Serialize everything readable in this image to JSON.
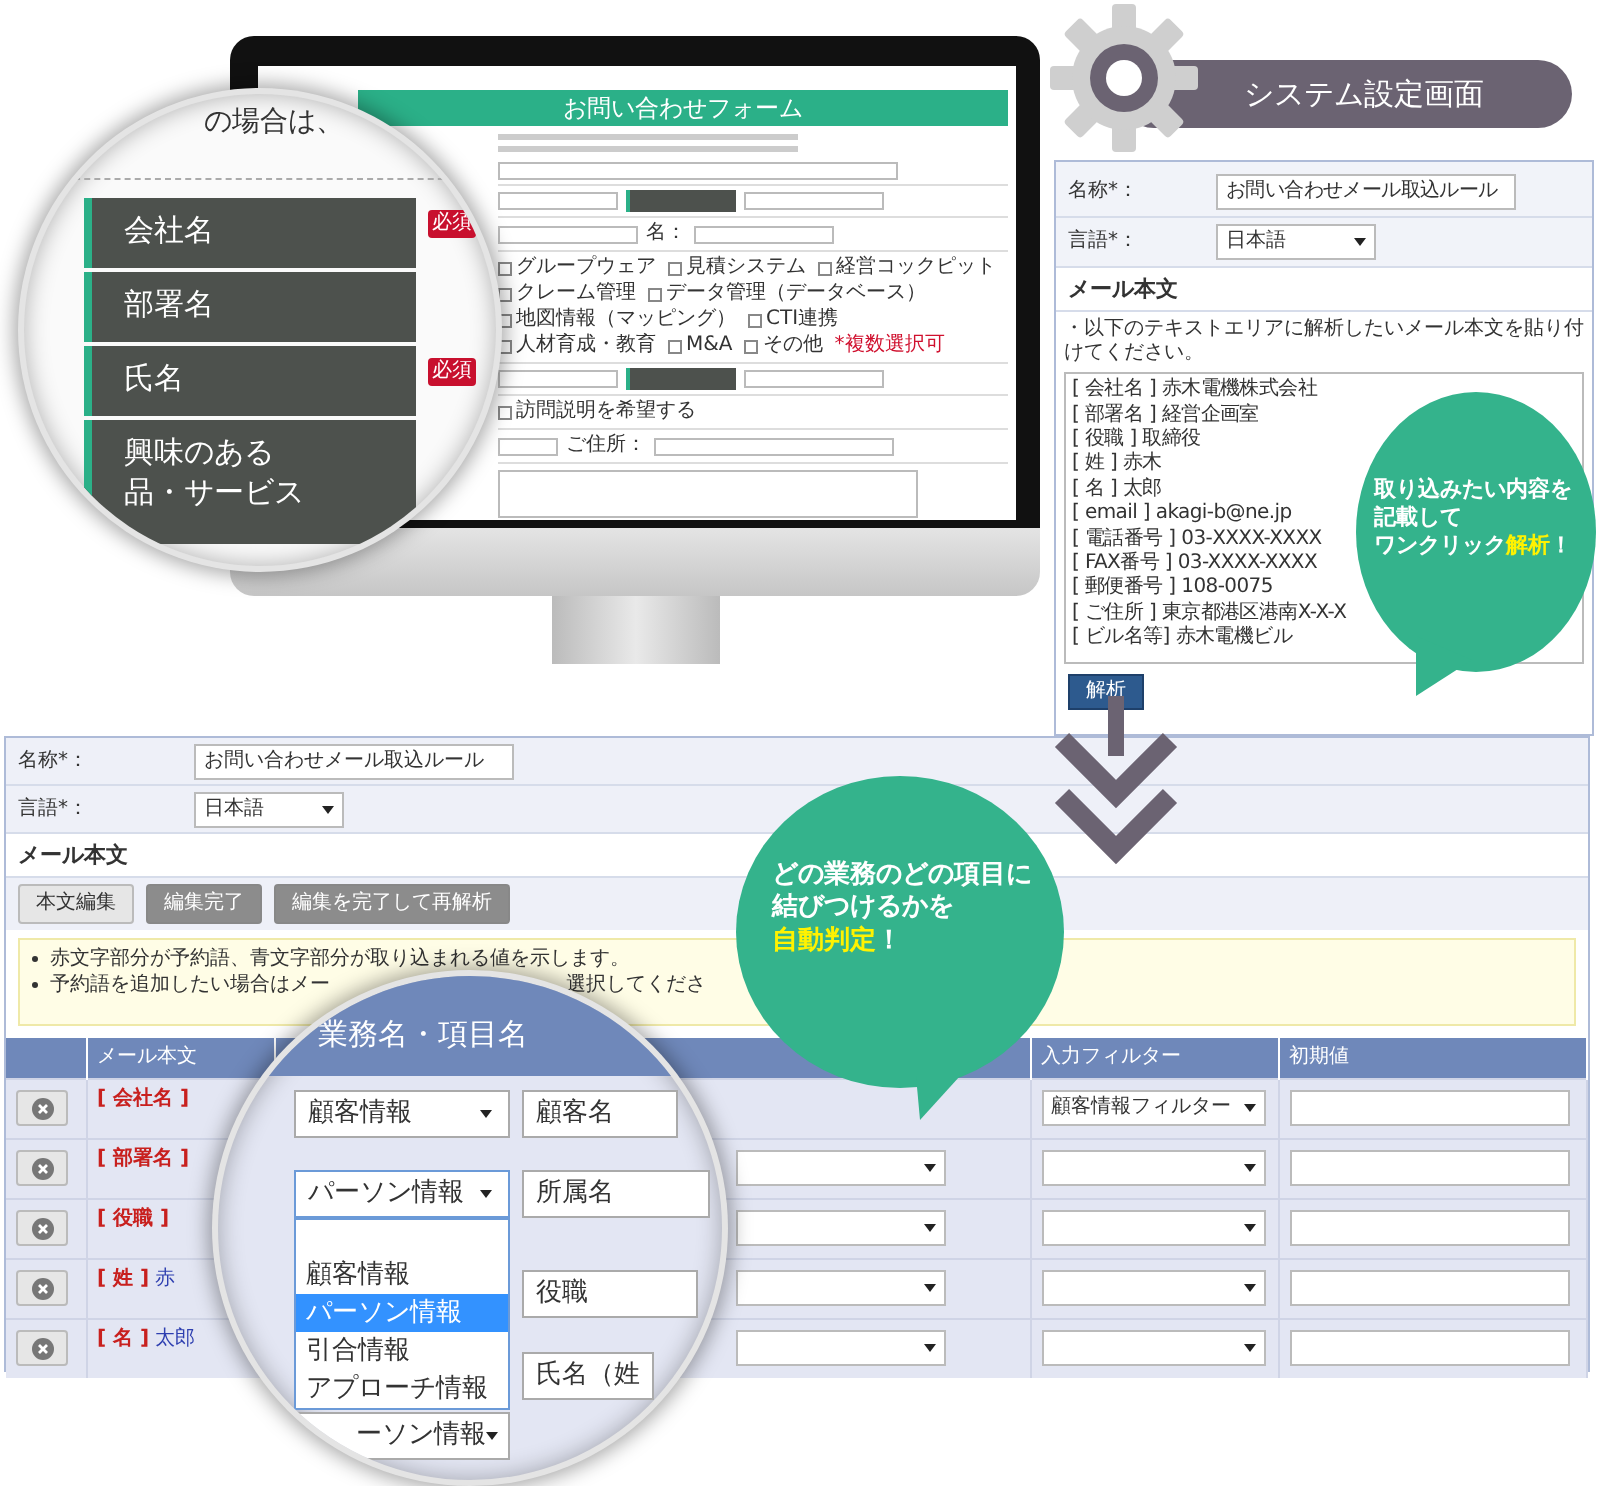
{
  "monitor": {
    "form_title": "お問い合わせフォーム",
    "given_name_label": "名：",
    "interests": [
      {
        "label": "グループウェア",
        "checked": false
      },
      {
        "label": "見積システム",
        "checked": false
      },
      {
        "label": "経営コックピット",
        "checked": false
      },
      {
        "label": "クレーム管理",
        "checked": false
      },
      {
        "label": "データ管理（データベース）",
        "checked": false
      },
      {
        "label": "地図情報（マッピング）",
        "checked": false
      },
      {
        "label": "CTI連携",
        "checked": false
      },
      {
        "label": "人材育成・教育",
        "checked": false
      },
      {
        "label": "M&A",
        "checked": false
      },
      {
        "label": "その他",
        "checked": false
      }
    ],
    "interests_note": "*複数選択可",
    "visit": {
      "label": "訪問説明を希望する",
      "checked": false
    },
    "address_label": "ご住所："
  },
  "monitor_magnifier": {
    "caption": "の場合は、",
    "fields": [
      {
        "lines": [
          "会社名"
        ],
        "badge": "必須"
      },
      {
        "lines": [
          "部署名"
        ]
      },
      {
        "lines": [
          "氏名"
        ],
        "badge": "必須"
      },
      {
        "lines": [
          "興味のある",
          "品・サービス"
        ]
      }
    ]
  },
  "settings": {
    "title": "システム設定画面",
    "name_label": "名称*：",
    "name_value": "お問い合わせメール取込ルール",
    "lang_label": "言語*：",
    "lang_value": "日本語",
    "body_heading": "メール本文",
    "hint": "・以下のテキストエリアに解析したいメール本文を貼り付けてください。",
    "mail_lines": [
      "[ 会社名 ] 赤木電機株式会社",
      "[ 部署名 ] 経営企画室",
      "[ 役職 ] 取締役",
      "[ 姓 ] 赤木",
      "[ 名 ] 太郎",
      "[ email ] akagi-b@ne.jp",
      "[ 電話番号 ] 03-XXXX-XXXX",
      "[ FAX番号 ] 03-XXXX-XXXX",
      "[ 郵便番号 ] 108-0075",
      "[ ご住所 ] 東京都港区港南X-X-X",
      "[ ビル名等] 赤木電機ビル"
    ],
    "parse_button": "解析"
  },
  "bubble_top": {
    "lines": [
      [
        {
          "text": "取り込みたい内容を",
          "highlight": false
        }
      ],
      [
        {
          "text": "記載して",
          "highlight": false
        }
      ],
      [
        {
          "text": "ワンクリック",
          "highlight": false
        },
        {
          "text": "解析",
          "highlight": true
        },
        {
          "text": "！",
          "highlight": false
        }
      ]
    ]
  },
  "rule_editor": {
    "name_label": "名称*：",
    "name_value": "お問い合わせメール取込ルール",
    "lang_label": "言語*：",
    "lang_value": "日本語",
    "body_heading": "メール本文",
    "buttons": [
      {
        "label": "本文編集",
        "disabled": false
      },
      {
        "label": "編集完了",
        "disabled": true
      },
      {
        "label": "編集を完了して再解析",
        "disabled": true
      }
    ],
    "notes": [
      {
        "parts": [
          "赤文字部分が予約語、青文字部分が取り込まれる値を示します。"
        ]
      },
      {
        "parts": [
          "予約語を追加したい場合はメー",
          "選択してくださ"
        ]
      }
    ],
    "columns": [
      "メール本文",
      "入力フィルター",
      "初期値"
    ],
    "rows": [
      {
        "key": "[ 会社名 ]",
        "filter": "顧客情報フィルター"
      },
      {
        "key": "[ 部署名 ]"
      },
      {
        "key": "[ 役職 ]"
      },
      {
        "key": "[ 姓 ]",
        "value": "赤"
      },
      {
        "key": "[ 名 ]",
        "value": "太郎"
      }
    ]
  },
  "bubble_bottom": {
    "lines": [
      [
        {
          "text": "どの業務のどの項目に",
          "highlight": false
        }
      ],
      [
        {
          "text": "結びつけるかを",
          "highlight": false
        }
      ],
      [
        {
          "text": "自動判定",
          "highlight": true
        },
        {
          "text": "！",
          "highlight": false
        }
      ]
    ]
  },
  "table_magnifier": {
    "header": "業務名・項目名",
    "rows": [
      {
        "category": "顧客情報",
        "item": "顧客名",
        "expanded": false
      },
      {
        "category": "パーソン情報",
        "item": "所属名",
        "expanded": true,
        "options": [
          {
            "kind": "blank",
            "selected": false
          },
          {
            "kind": "option",
            "label": "顧客情報",
            "selected": false
          },
          {
            "kind": "option",
            "label": "パーソン情報",
            "selected": true
          },
          {
            "kind": "option",
            "label": "引合情報",
            "selected": false
          },
          {
            "kind": "option",
            "label": "アプローチ情報",
            "selected": false
          }
        ]
      },
      {
        "item": "役職"
      },
      {
        "item": "氏名（姓"
      },
      {
        "category": "ーソン情報",
        "expanded": false
      }
    ]
  }
}
